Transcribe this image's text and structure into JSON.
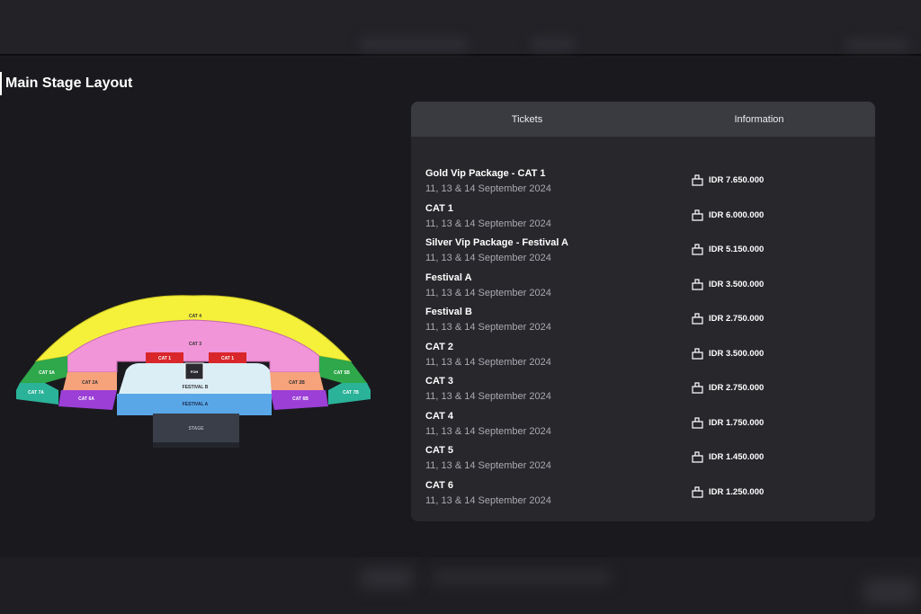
{
  "page": {
    "title": "Main Stage Layout"
  },
  "tabs": [
    {
      "label": "Tickets"
    },
    {
      "label": "Information"
    }
  ],
  "tickets": [
    {
      "name": "Gold Vip Package - CAT 1",
      "date": "11, 13 & 14 September 2024",
      "price": "IDR 7.650.000"
    },
    {
      "name": "CAT 1",
      "date": "11, 13 & 14 September 2024",
      "price": "IDR 6.000.000"
    },
    {
      "name": "Silver Vip Package - Festival A",
      "date": "11, 13 & 14 September 2024",
      "price": "IDR 5.150.000"
    },
    {
      "name": "Festival A",
      "date": "11, 13 & 14 September 2024",
      "price": "IDR 3.500.000"
    },
    {
      "name": "Festival B",
      "date": "11, 13 & 14 September 2024",
      "price": "IDR 2.750.000"
    },
    {
      "name": "CAT 2",
      "date": "11, 13 & 14 September 2024",
      "price": "IDR 3.500.000"
    },
    {
      "name": "CAT 3",
      "date": "11, 13 & 14 September 2024",
      "price": "IDR 2.750.000"
    },
    {
      "name": "CAT 4",
      "date": "11, 13 & 14 September 2024",
      "price": "IDR 1.750.000"
    },
    {
      "name": "CAT 5",
      "date": "11, 13 & 14 September 2024",
      "price": "IDR 1.450.000"
    },
    {
      "name": "CAT 6",
      "date": "11, 13 & 14 September 2024",
      "price": "IDR 1.250.000"
    }
  ],
  "seatmap": {
    "sections": {
      "cat4": {
        "label": "CAT 4",
        "color": "#f5f03a"
      },
      "cat3": {
        "label": "CAT 3",
        "color": "#f294d8"
      },
      "cat1_left": {
        "label": "CAT 1",
        "color": "#d8262a"
      },
      "cat1_right": {
        "label": "CAT 1",
        "color": "#d8262a"
      },
      "cat2a": {
        "label": "CAT 2A",
        "color": "#f6a27a"
      },
      "cat2b": {
        "label": "CAT 2B",
        "color": "#f6a27a"
      },
      "cat5a": {
        "label": "CAT 5A",
        "color": "#2ea84a"
      },
      "cat5b": {
        "label": "CAT 5B",
        "color": "#2ea84a"
      },
      "cat6a": {
        "label": "CAT 6A",
        "color": "#9b3fd6"
      },
      "cat6b": {
        "label": "CAT 6B",
        "color": "#9b3fd6"
      },
      "cat7a": {
        "label": "CAT 7A",
        "color": "#2bb39a"
      },
      "cat7b": {
        "label": "CAT 7B",
        "color": "#2bb39a"
      },
      "festival_b": {
        "label": "FESTIVAL B",
        "color": "#dbeef6"
      },
      "festival_a": {
        "label": "FESTIVAL A",
        "color": "#5aa7e8"
      },
      "foh": {
        "label": "FOH",
        "color": "#2a2a30"
      },
      "stage": {
        "label": "STAGE",
        "color": "#3a3e48"
      }
    }
  }
}
